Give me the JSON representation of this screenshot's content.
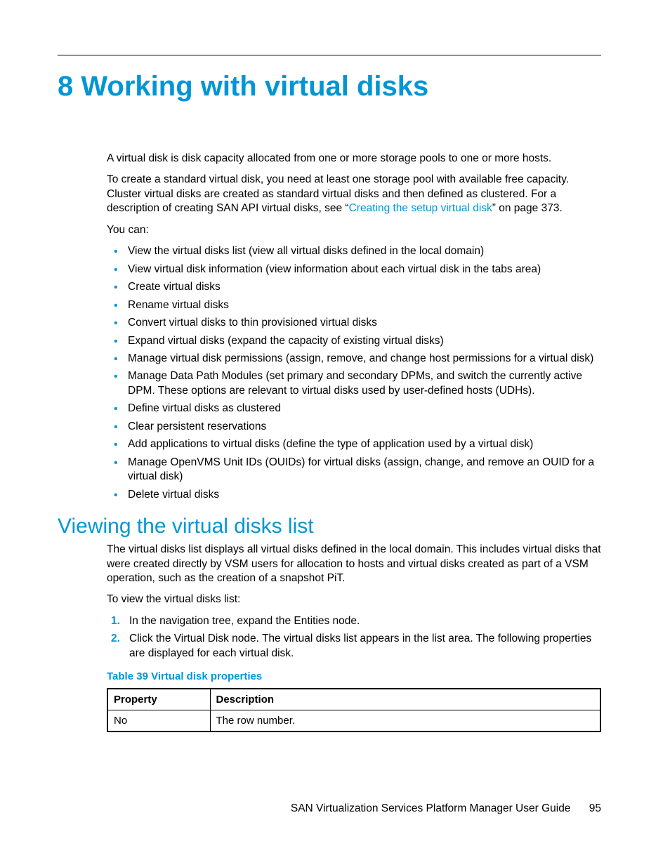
{
  "chapter": {
    "number": "8",
    "title": "Working with virtual disks"
  },
  "intro": {
    "p1": "A virtual disk is disk capacity allocated from one or more storage pools to one or more hosts.",
    "p2a": "To create a standard virtual disk, you need at least one storage pool with available free capacity. Cluster virtual disks are created as standard virtual disks and then defined as clustered. For a description of creating SAN API virtual disks, see “",
    "p2_link": "Creating the setup virtual disk",
    "p2b": "” on page 373.",
    "you_can": "You can:",
    "bullets": [
      "View the virtual disks list (view all virtual disks defined in the local domain)",
      "View virtual disk information (view information about each virtual disk in the tabs area)",
      "Create virtual disks",
      "Rename virtual disks",
      "Convert virtual disks to thin provisioned virtual disks",
      "Expand virtual disks (expand the capacity of existing virtual disks)",
      "Manage virtual disk permissions (assign, remove, and change host permissions for a virtual disk)",
      "Manage Data Path Modules (set primary and secondary DPMs, and switch the currently active DPM. These options are relevant to virtual disks used by user-defined hosts (UDHs).",
      "Define virtual disks as clustered",
      "Clear persistent reservations",
      "Add applications to virtual disks (define the type of application used by a virtual disk)",
      "Manage OpenVMS Unit IDs (OUIDs) for virtual disks (assign, change, and remove an OUID for a virtual disk)",
      "Delete virtual disks"
    ]
  },
  "section": {
    "title": "Viewing the virtual disks list",
    "p1": "The virtual disks list displays all virtual disks defined in the local domain. This includes virtual disks that were created directly by VSM users for allocation to hosts and virtual disks created as part of a VSM operation, such as the creation of a snapshot PiT.",
    "p2": "To view the virtual disks list:",
    "steps": [
      "In the navigation tree, expand the Entities node.",
      "Click the Virtual Disk node. The virtual disks list appears in the list area. The following properties are displayed for each virtual disk."
    ],
    "table_caption": "Table 39 Virtual disk properties",
    "table": {
      "headers": [
        "Property",
        "Description"
      ],
      "rows": [
        [
          "No",
          "The row number."
        ]
      ]
    }
  },
  "footer": {
    "text": "SAN Virtualization Services Platform Manager User Guide",
    "page": "95"
  }
}
